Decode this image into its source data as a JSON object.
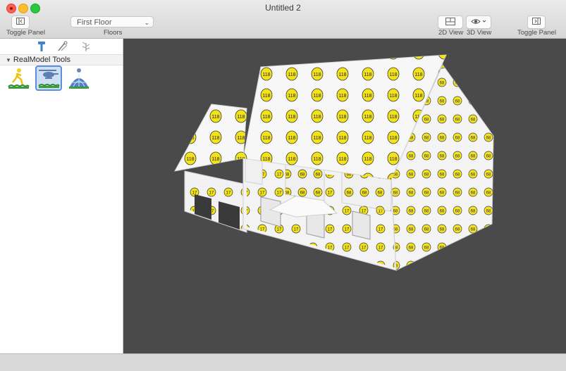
{
  "window": {
    "title": "Untitled 2"
  },
  "toolbar": {
    "toggle_panel_left_label": "Toggle Panel",
    "floor_select_value": "First Floor",
    "floors_label": "Floors",
    "view_2d_label": "2D View",
    "view_3d_label": "3D View",
    "toggle_panel_right_label": "Toggle Panel"
  },
  "sidebar": {
    "tabs": [
      "hammer-icon",
      "paint-tools-icon",
      "plant-icon"
    ],
    "section_title": "RealModel Tools",
    "tools": [
      "walkthrough-person-icon",
      "aerial-helicopter-icon",
      "dome-tour-icon"
    ],
    "selected_tool": "aerial-helicopter-icon"
  },
  "viewport": {
    "marker_labels": {
      "roof": "118",
      "upper_wall": "68",
      "lower_wall": "17"
    }
  },
  "colors": {
    "viewport_bg": "#4a4a4a",
    "marker_fill": "#f2e21a",
    "selection": "#5b8fd6"
  }
}
